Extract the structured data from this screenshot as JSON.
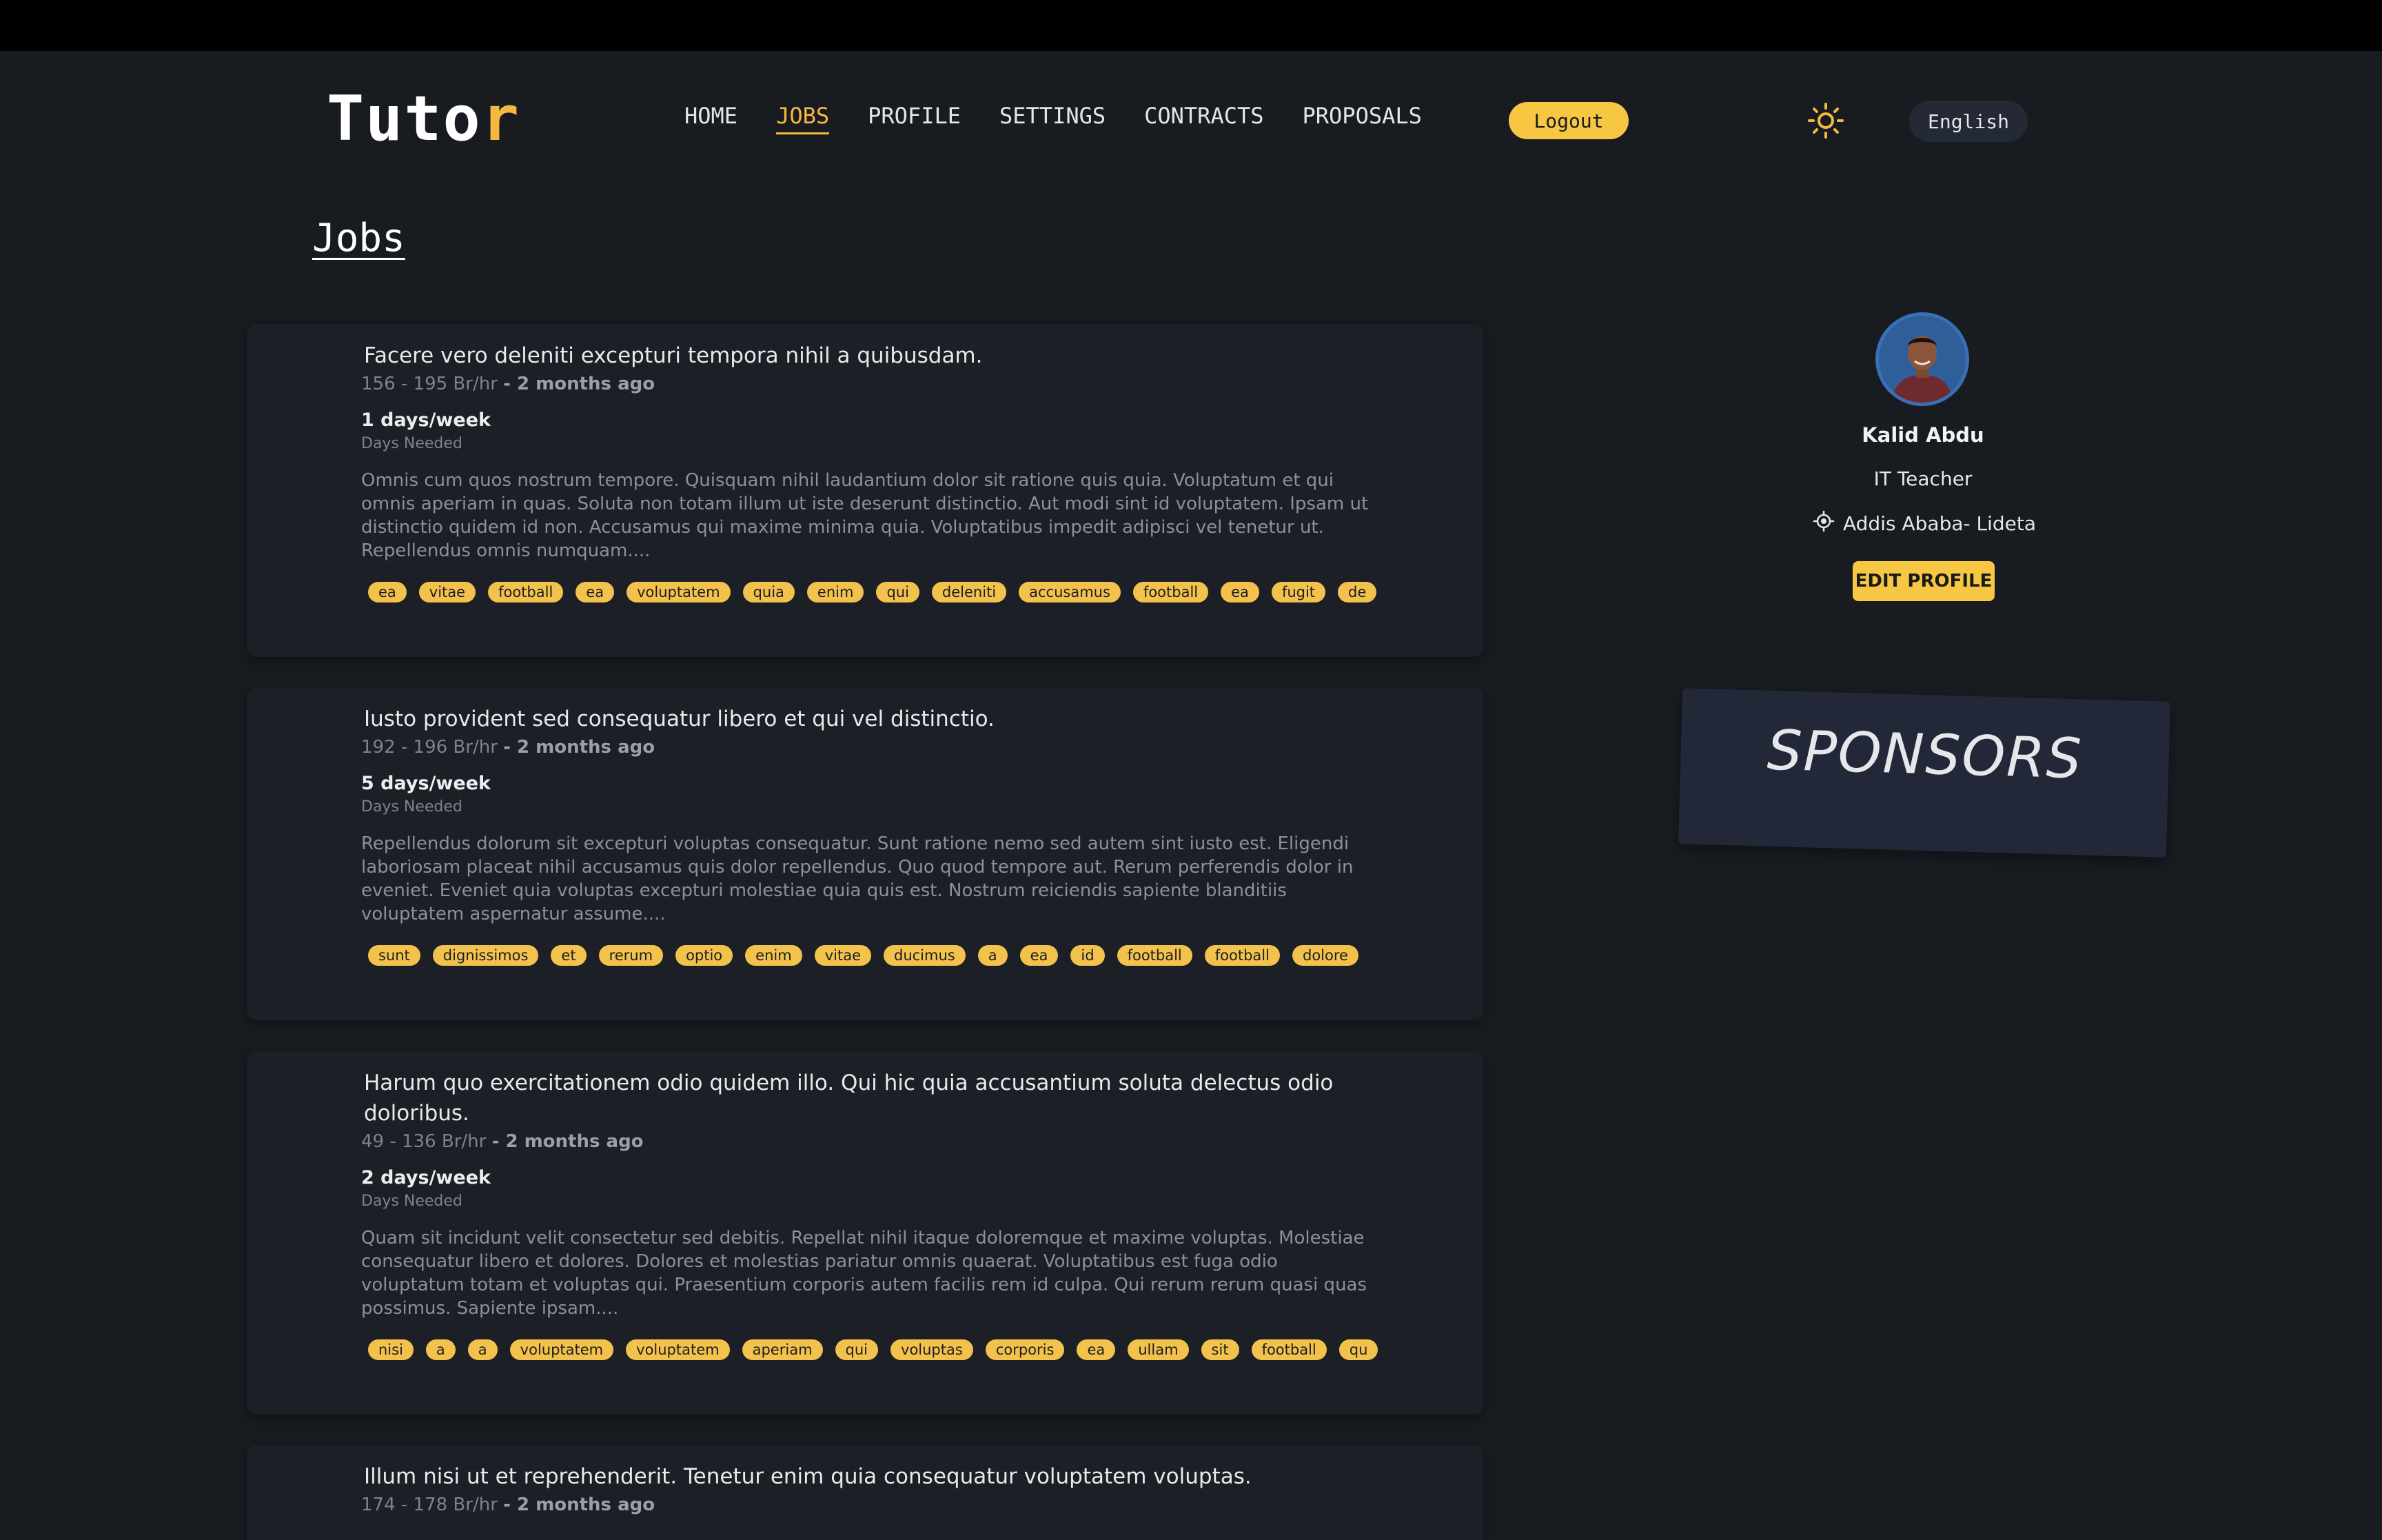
{
  "app": {
    "logo_main": "Tuto",
    "logo_accent": "r"
  },
  "nav": {
    "items": [
      {
        "label": "HOME",
        "active": false
      },
      {
        "label": "JOBS",
        "active": true
      },
      {
        "label": "PROFILE",
        "active": false
      },
      {
        "label": "SETTINGS",
        "active": false
      },
      {
        "label": "CONTRACTS",
        "active": false
      },
      {
        "label": "PROPOSALS",
        "active": false
      }
    ],
    "logout_label": "Logout",
    "theme_icon": "sun-icon",
    "language": "English"
  },
  "page": {
    "title": "Jobs"
  },
  "jobs": [
    {
      "title": "Facere vero deleniti excepturi tempora nihil a quibusdam.",
      "rate": "156 - 195 Br/hr",
      "posted": "- 2 months ago",
      "days": "1 days/week",
      "days_label": "Days Needed",
      "description": "Omnis cum quos nostrum tempore. Quisquam nihil laudantium dolor sit ratione quis quia. Voluptatum et qui omnis aperiam in quas. Soluta non totam illum ut iste deserunt distinctio. Aut modi sint id voluptatem. Ipsam ut distinctio quidem id non. Accusamus qui maxime minima quia. Voluptatibus impedit adipisci vel tenetur ut. Repellendus omnis numquam....",
      "tags": [
        "ea",
        "vitae",
        "football",
        "ea",
        "voluptatem",
        "quia",
        "enim",
        "qui",
        "deleniti",
        "accusamus",
        "football",
        "ea",
        "fugit",
        "de"
      ]
    },
    {
      "title": "Iusto provident sed consequatur libero et qui vel distinctio.",
      "rate": "192 - 196 Br/hr",
      "posted": "- 2 months ago",
      "days": "5 days/week",
      "days_label": "Days Needed",
      "description": "Repellendus dolorum sit excepturi voluptas consequatur. Sunt ratione nemo sed autem sint iusto est. Eligendi laboriosam placeat nihil accusamus quis dolor repellendus. Quo quod tempore aut. Rerum perferendis dolor in eveniet. Eveniet quia voluptas excepturi molestiae quia quis est. Nostrum reiciendis sapiente blanditiis voluptatem aspernatur assume....",
      "tags": [
        "sunt",
        "dignissimos",
        "et",
        "rerum",
        "optio",
        "enim",
        "vitae",
        "ducimus",
        "a",
        "ea",
        "id",
        "football",
        "football",
        "dolore"
      ]
    },
    {
      "title": "Harum quo exercitationem odio quidem illo. Qui hic quia accusantium soluta delectus odio doloribus.",
      "rate": "49 - 136 Br/hr",
      "posted": "- 2 months ago",
      "days": "2 days/week",
      "days_label": "Days Needed",
      "description": "Quam sit incidunt velit consectetur sed debitis. Repellat nihil itaque doloremque et maxime voluptas. Molestiae consequatur libero et dolores. Dolores et molestias pariatur omnis quaerat. Voluptatibus est fuga odio voluptatum totam et voluptas qui. Praesentium corporis autem facilis rem id culpa. Qui rerum rerum quasi quas possimus. Sapiente ipsam....",
      "tags": [
        "nisi",
        "a",
        "a",
        "voluptatem",
        "voluptatem",
        "aperiam",
        "qui",
        "voluptas",
        "corporis",
        "ea",
        "ullam",
        "sit",
        "football",
        "qu"
      ]
    },
    {
      "title": "Illum nisi ut et reprehenderit. Tenetur enim quia consequatur voluptatem voluptas.",
      "rate": "174 - 178 Br/hr",
      "posted": "- 2 months ago"
    }
  ],
  "profile": {
    "name": "Kalid Abdu",
    "role": "IT Teacher",
    "location": "Addis Ababa- Lideta",
    "edit_label": "EDIT PROFILE"
  },
  "sponsors": {
    "title": "SPONSORS"
  },
  "colors": {
    "accent": "#f5b942",
    "tag_bg": "#f2c24d",
    "background": "#181b20",
    "card": "#1c1f25"
  }
}
